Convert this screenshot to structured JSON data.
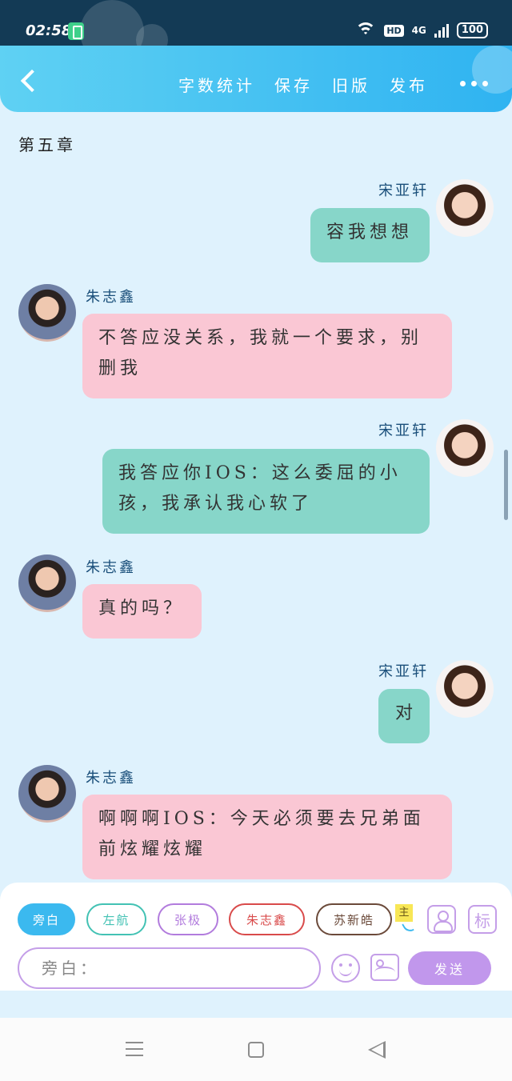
{
  "status_bar": {
    "time": "02:58",
    "hd": "HD",
    "network": "4G",
    "battery": "100"
  },
  "header": {
    "actions": [
      "字数统计",
      "保存",
      "旧版",
      "发布"
    ]
  },
  "chapter_title": "第五章",
  "messages": [
    {
      "side": "right",
      "sender": "宋亚轩",
      "text": "容我想想"
    },
    {
      "side": "left",
      "sender": "朱志鑫",
      "text": "不答应没关系，我就一个要求，别删我"
    },
    {
      "side": "right",
      "sender": "宋亚轩",
      "text": "我答应你IOS：这么委屈的小孩，我承认我心软了"
    },
    {
      "side": "left",
      "sender": "朱志鑫",
      "text": "真的吗？"
    },
    {
      "side": "right",
      "sender": "宋亚轩",
      "text": "对"
    },
    {
      "side": "left",
      "sender": "朱志鑫",
      "text": "啊啊啊IOS：今天必须要去兄弟面前炫耀炫耀"
    }
  ],
  "roles": [
    {
      "label": "旁白",
      "color": "#3bb9ef",
      "active": true
    },
    {
      "label": "左航",
      "color": "#43c2b4",
      "active": false
    },
    {
      "label": "张极",
      "color": "#b27cdd",
      "active": false
    },
    {
      "label": "朱志鑫",
      "color": "#d94b4b",
      "active": false
    },
    {
      "label": "苏新皓",
      "color": "#6b4a3a",
      "active": false
    }
  ],
  "main_tag": "主",
  "label_button": "标",
  "input": {
    "value": "旁白：",
    "placeholder": ""
  },
  "send_label": "发送",
  "colors": {
    "header_start": "#5fd1f3",
    "header_end": "#2fb3f1",
    "right_bubble": "#87d6c9",
    "left_bubble": "#fac7d4",
    "accent_purple": "#c197ec",
    "background": "#dff2fd"
  }
}
